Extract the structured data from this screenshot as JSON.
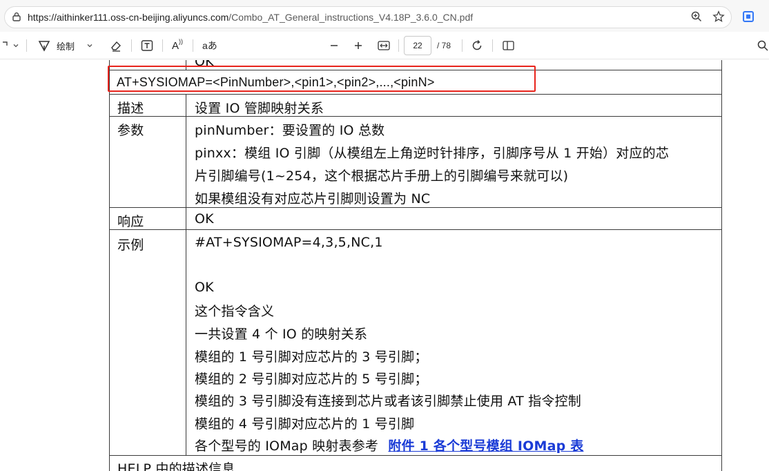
{
  "browser": {
    "url_host": "https://aithinker111.oss-cn-beijing.aliyuncs.com",
    "url_path": "/Combo_AT_General_instructions_V4.18P_3.6.0_CN.pdf"
  },
  "pdf_toolbar": {
    "draw_label": "绘制",
    "text_style_label": "aあ",
    "read_aloud_label": "A",
    "page_current": "22",
    "page_total": "/ 78"
  },
  "doc": {
    "top_cut_text": "OK",
    "command": "AT+SYSIOMAP=<PinNumber>,<pin1>,<pin2>,...,<pinN>",
    "rows": [
      {
        "label": "描述",
        "lines": [
          "设置 IO 管脚映射关系"
        ]
      },
      {
        "label": "参数",
        "lines": [
          "pinNumber：要设置的 IO 总数",
          "pinxx：模组 IO 引脚（从模组左上角逆时针排序，引脚序号从 1 开始）对应的芯",
          "片引脚编号(1~254，这个根据芯片手册上的引脚编号来就可以)",
          "如果模组没有对应芯片引脚则设置为 NC"
        ]
      },
      {
        "label": "响应",
        "lines": [
          "OK"
        ]
      },
      {
        "label": "示例",
        "lines": [
          "#AT+SYSIOMAP=4,3,5,NC,1",
          "",
          "OK",
          "这个指令含义",
          "一共设置 4 个 IO 的映射关系",
          "模组的 1 号引脚对应芯片的 3 号引脚；",
          "模组的 2 号引脚对应芯片的 5 号引脚；",
          "模组的 3 号引脚没有连接到芯片或者该引脚禁止使用 AT 指令控制",
          "模组的 4 号引脚对应芯片的 1 号引脚"
        ]
      }
    ],
    "iomap_prefix": "各个型号的 IOMap 映射表参考",
    "iomap_link": "附件 1  各个型号模组 IOMap 表",
    "bottom_cut_text": "HELP 中的描述信息"
  }
}
